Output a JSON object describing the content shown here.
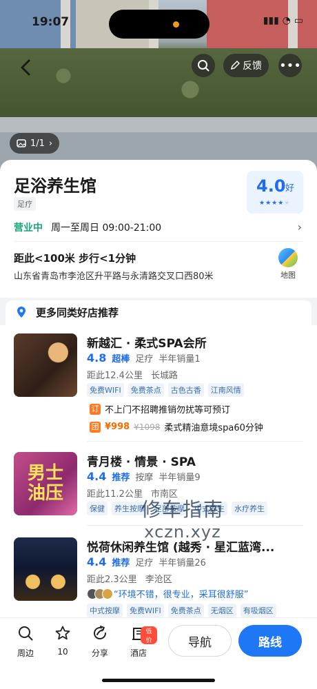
{
  "status_bar": {
    "time": "19:07"
  },
  "header": {
    "feedback_label": "反馈",
    "photo_count": "1/1"
  },
  "shop": {
    "name": "足浴养生馆",
    "category_tag": "足疗",
    "rating": "4.0",
    "rating_word": "好",
    "rating_stars": 4,
    "open_status": "营业中",
    "hours": "周一至周日 09:00-21:00",
    "distance": "距此<100米  步行<1分钟",
    "address": "山东省青岛市李沧区升平路与永清路交叉口西80米",
    "map_label": "地图"
  },
  "recommend": {
    "title": "更多同类好店推荐",
    "items": [
      {
        "name": "新越汇 · 柔式SPA会所",
        "score": "4.8",
        "level": "超棒",
        "category": "足疗",
        "sales": "半年销量1",
        "distance": "距此12.4公里",
        "area": "长城路",
        "tags": [
          "免费WIFI",
          "免费茶点",
          "古色古香",
          "江南风情"
        ],
        "promo_note_badge": "订",
        "promo_note": "不上门不招聘推销勿扰等可预订",
        "deal_badge": "团",
        "deal_price": "¥998",
        "deal_orig": "¥1098",
        "deal_name": "柔式精油意境spa60分钟"
      },
      {
        "name": "青月楼 · 情景 · SPA",
        "score": "4.4",
        "level": "推荐",
        "category": "按摩",
        "sales": "半年销量9",
        "distance": "距此11.2公里",
        "area": "市南区",
        "thumb_text": [
          "男士",
          "油压"
        ],
        "tags": [
          "保健",
          "养生按摩",
          "足部按摩",
          "中式养生",
          "水疗养生"
        ]
      },
      {
        "name": "悦荷休闲养生馆 (越秀 · 星汇蓝湾...",
        "score": "4.4",
        "level": "推荐",
        "category": "足疗",
        "sales": "半年销量26",
        "distance": "距此2.3公里",
        "area": "李沧区",
        "quote": "“环境不错，很专业，采耳很舒服”",
        "tags": [
          "中式按摩",
          "免费WIFI",
          "免费茶点",
          "无烟区",
          "有吸烟区"
        ]
      }
    ]
  },
  "watermark": {
    "line1": "修车指南",
    "line2": "xczn.xyz"
  },
  "bottom_bar": {
    "tabs": [
      {
        "label": "周边"
      },
      {
        "label": "10"
      },
      {
        "label": "分享"
      },
      {
        "label": "酒店",
        "badge": "低价"
      }
    ],
    "nav_label": "导航",
    "route_label": "路线"
  },
  "colors": {
    "accent": "#1e78f5",
    "open": "#1aa57a",
    "price": "#ff6a00"
  }
}
